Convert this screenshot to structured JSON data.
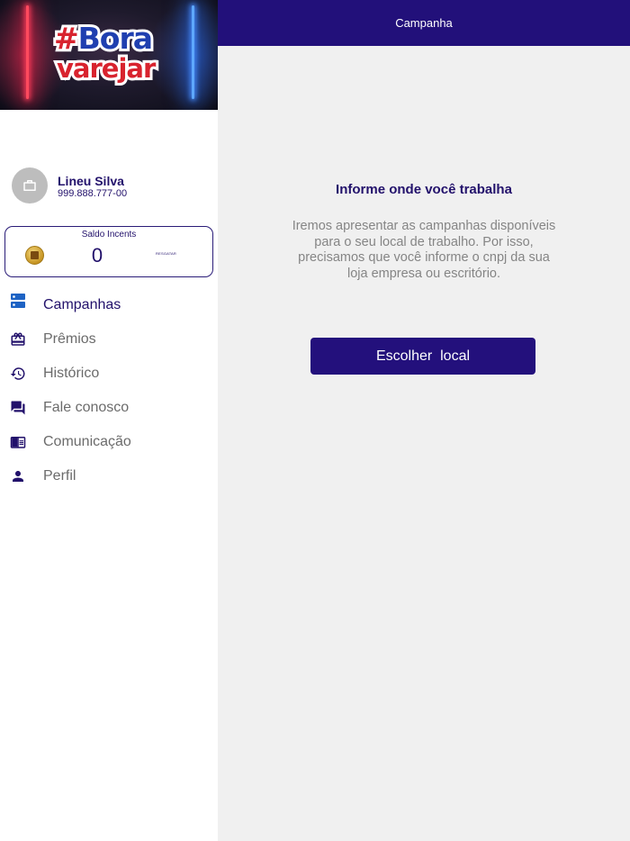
{
  "topbar": {
    "title": "Campanha"
  },
  "banner": {
    "logo_line1_hash": "#",
    "logo_line1_word": "Bora",
    "logo_line2": "varejar"
  },
  "profile": {
    "name": "Lineu Silva",
    "document": "999.888.777-00",
    "avatar_icon": "briefcase-icon"
  },
  "balance": {
    "label": "Saldo Incents",
    "value": "0",
    "redeem_label": "RESGATAR",
    "coin_icon": "coin-icon"
  },
  "menu": {
    "items": [
      {
        "label": "Campanhas",
        "icon": "campaigns-icon",
        "active": true
      },
      {
        "label": "Prêmios",
        "icon": "gift-icon",
        "active": false
      },
      {
        "label": "Histórico",
        "icon": "history-icon",
        "active": false
      },
      {
        "label": "Fale conosco",
        "icon": "chat-icon",
        "active": false
      },
      {
        "label": "Comunicação",
        "icon": "newspaper-icon",
        "active": false
      },
      {
        "label": "Perfil",
        "icon": "person-icon",
        "active": false
      }
    ]
  },
  "main": {
    "heading": "Informe onde você trabalha",
    "description": "Iremos apresentar as campanhas disponíveis para o seu local de trabalho. Por isso, precisamos que você informe o cnpj da sua loja empresa ou escritório.",
    "button_label": "Escolher  local"
  },
  "colors": {
    "primary": "#22107a",
    "text_primary": "#22116b",
    "text_muted": "#858585",
    "menu_text": "#6b6b6b",
    "main_background": "#f0f0f0",
    "active_icon": "#1e63c4"
  }
}
